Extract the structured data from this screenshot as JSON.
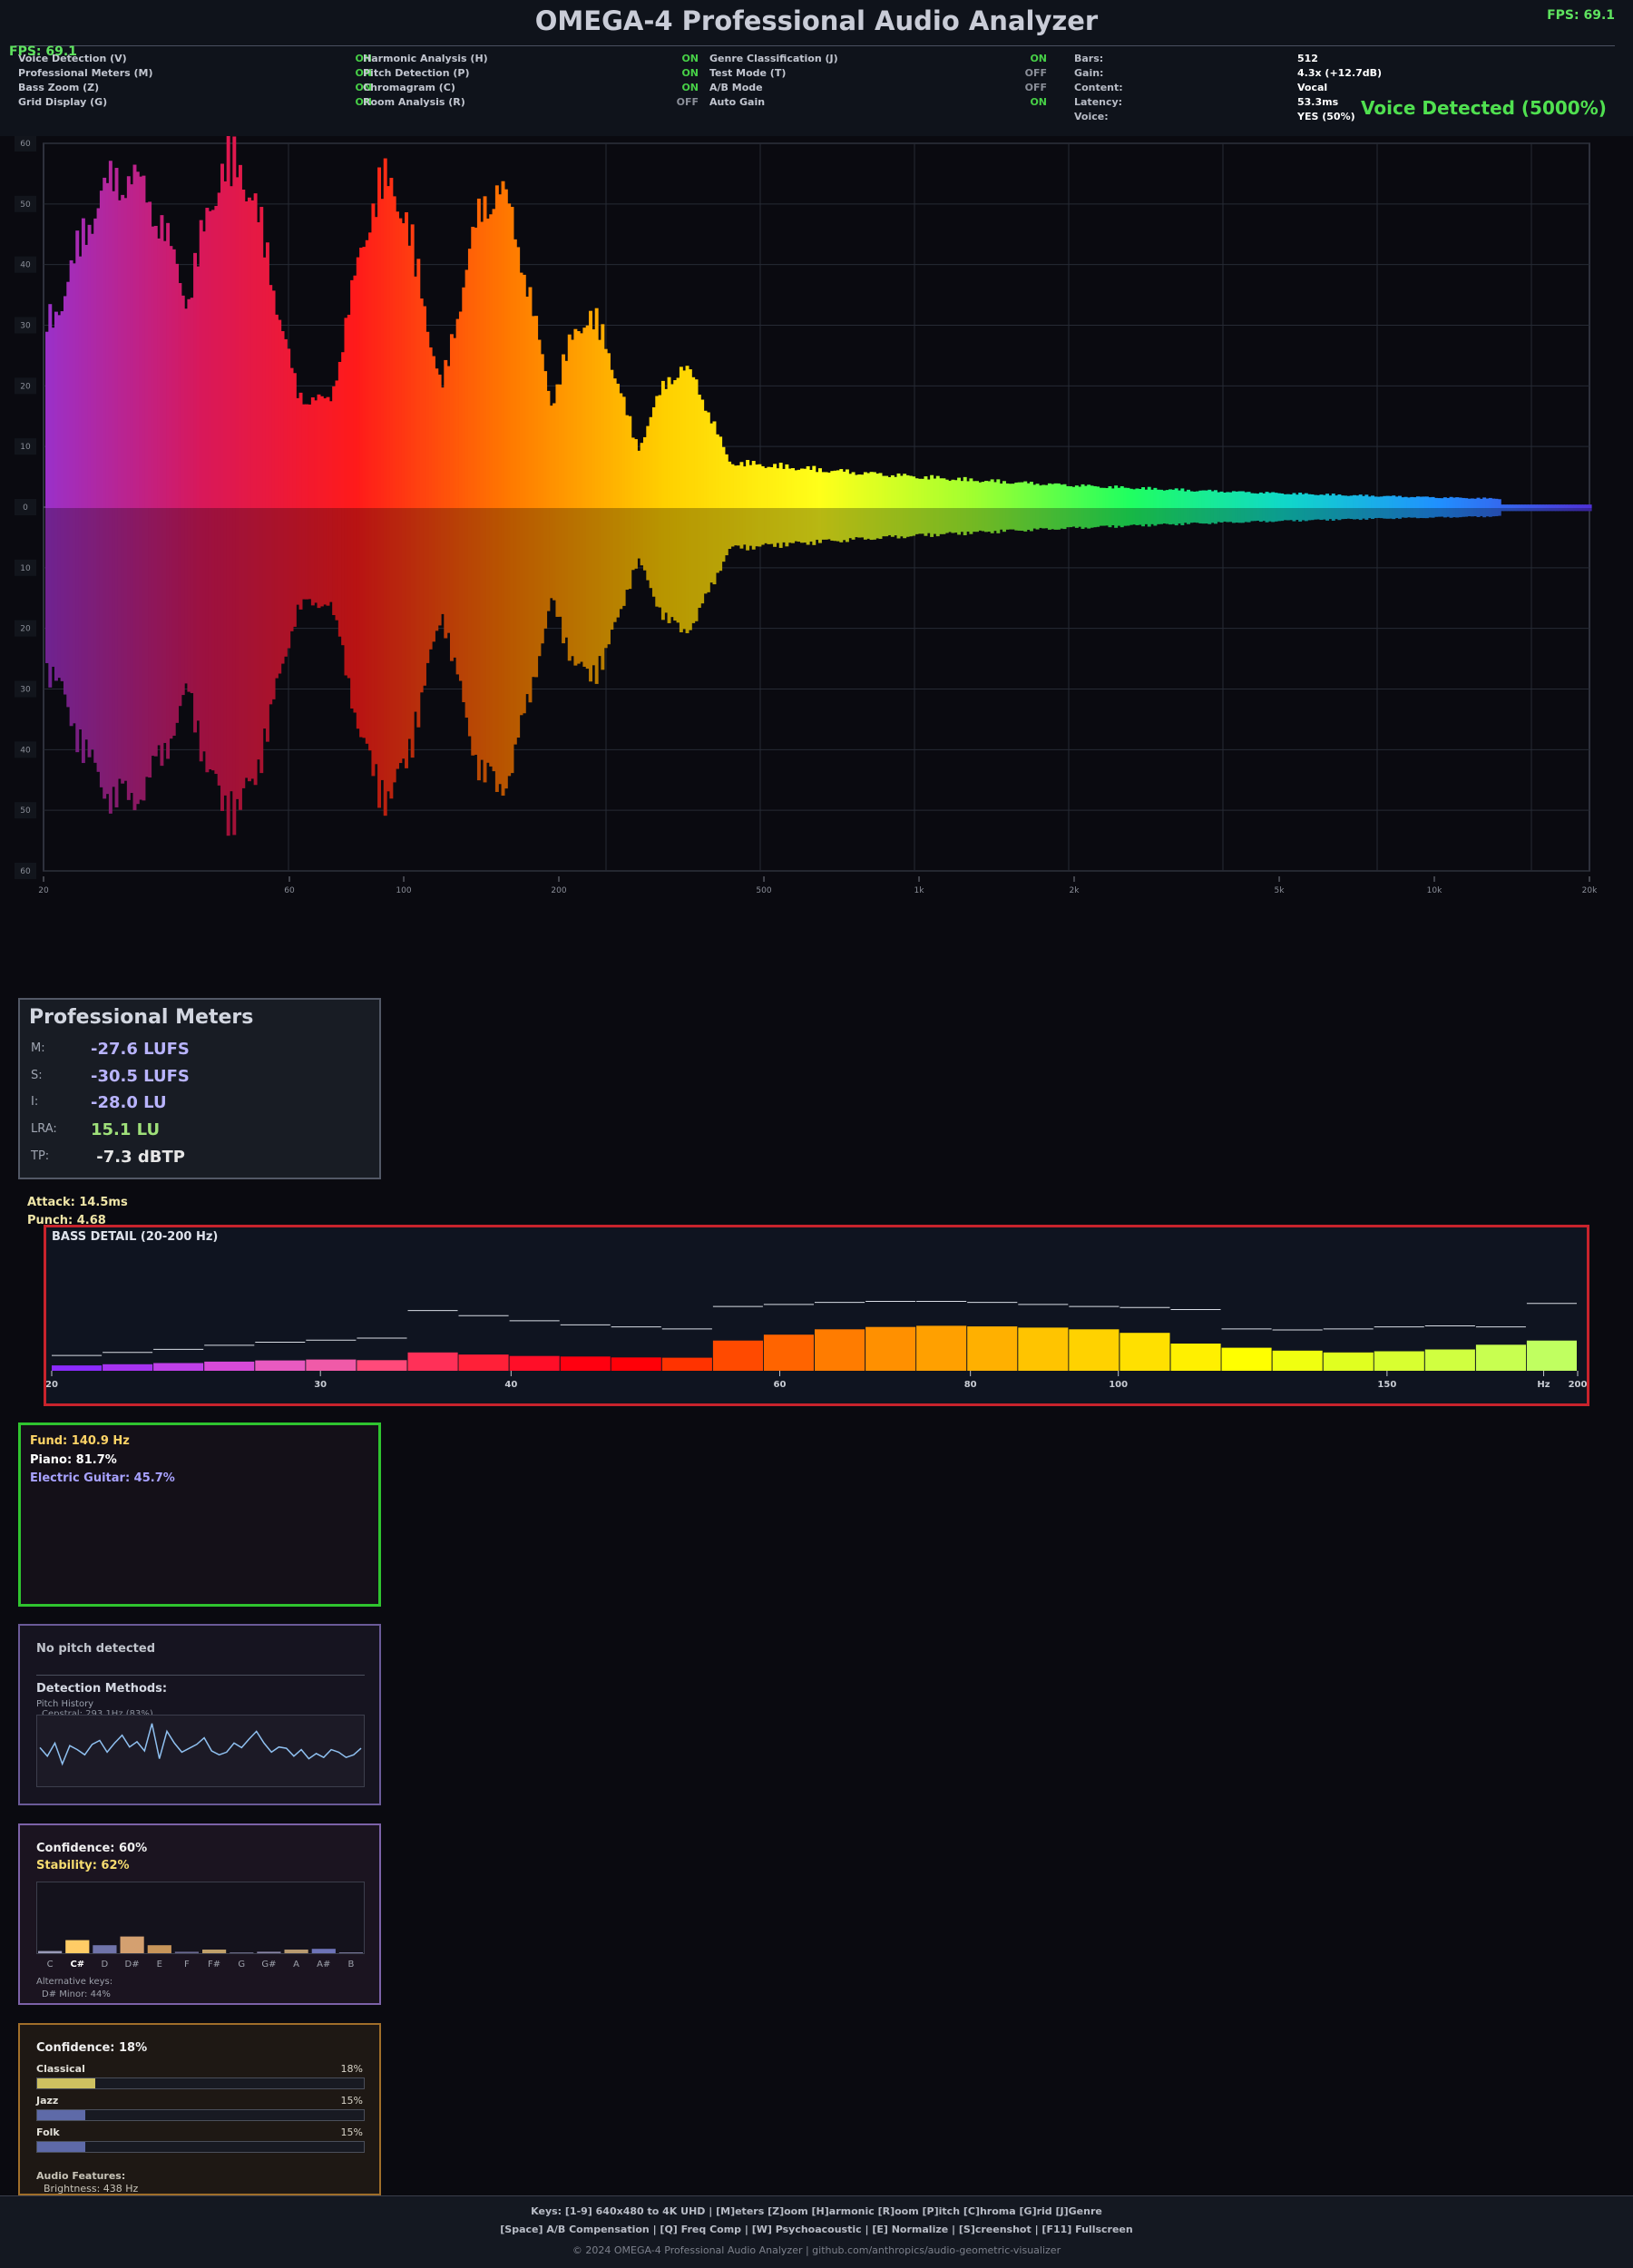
{
  "app": {
    "title": "OMEGA-4 Professional Audio Analyzer",
    "fps": "FPS: 69.1",
    "voice_status": "Voice Detected (5000%)"
  },
  "toggles": [
    {
      "label": "Voice Detection (V)",
      "state": "ON"
    },
    {
      "label": "Professional Meters (M)",
      "state": "ON"
    },
    {
      "label": "Bass Zoom (Z)",
      "state": "ON"
    },
    {
      "label": "Grid Display (G)",
      "state": "ON"
    },
    {
      "label": "Harmonic Analysis (H)",
      "state": "ON"
    },
    {
      "label": "Pitch Detection (P)",
      "state": "ON"
    },
    {
      "label": "Chromagram (C)",
      "state": "ON"
    },
    {
      "label": "Room Analysis (R)",
      "state": "OFF"
    },
    {
      "label": "Genre Classification (J)",
      "state": "ON"
    },
    {
      "label": "Test Mode (T)",
      "state": "OFF"
    },
    {
      "label": "A/B Mode",
      "state": "OFF"
    },
    {
      "label": "Auto Gain",
      "state": "ON"
    }
  ],
  "info": [
    {
      "key": "Bars:",
      "value": "512"
    },
    {
      "key": "Gain:",
      "value": "4.3x (+12.7dB)"
    },
    {
      "key": "Content:",
      "value": "Vocal"
    },
    {
      "key": "Latency:",
      "value": "53.3ms"
    },
    {
      "key": "Voice:",
      "value": "YES (50%)"
    }
  ],
  "spectrum": {
    "db_labels": [
      "60",
      "50",
      "40",
      "30",
      "20",
      "10",
      "0",
      "10",
      "20",
      "30",
      "40",
      "50",
      "60"
    ],
    "freq_labels": [
      {
        "label": "20",
        "hz": 20
      },
      {
        "label": "60",
        "hz": 60
      },
      {
        "label": "100",
        "hz": 100
      },
      {
        "label": "200",
        "hz": 200
      },
      {
        "label": "500",
        "hz": 500
      },
      {
        "label": "1k",
        "hz": 1000
      },
      {
        "label": "2k",
        "hz": 2000
      },
      {
        "label": "5k",
        "hz": 5000
      },
      {
        "label": "10k",
        "hz": 10000
      },
      {
        "label": "20k",
        "hz": 20000
      }
    ],
    "db_range": [
      -60,
      60
    ],
    "freq_range": [
      20,
      20000
    ],
    "colors": [
      "#9b30c8",
      "#d8185a",
      "#ff1a1a",
      "#ff7a00",
      "#ffd000",
      "#ffff1a",
      "#a0ff30",
      "#20ff60",
      "#10d8c8",
      "#2090ff",
      "#5030d8"
    ]
  },
  "meters": {
    "title": "Professional Meters",
    "rows": [
      {
        "label": "M:",
        "value": "-27.6 LUFS",
        "color": "#b9b4ff"
      },
      {
        "label": "S:",
        "value": "-30.5 LUFS",
        "color": "#b9b4ff"
      },
      {
        "label": "I:",
        "value": "-28.0 LU",
        "color": "#b9b4ff"
      },
      {
        "label": "LRA:",
        "value": "15.1 LU",
        "color": "#9fe07a"
      },
      {
        "label": "TP:",
        "value": " -7.3 dBTP",
        "color": "#e6e6e6"
      }
    ]
  },
  "transients": {
    "attack": "Attack: 14.5ms",
    "punch": "Punch: 4.68"
  },
  "bass": {
    "title": "BASS DETAIL (20-200 Hz)",
    "freq_labels": [
      {
        "label": "20",
        "hz": 20
      },
      {
        "label": "30",
        "hz": 30
      },
      {
        "label": "40",
        "hz": 40
      },
      {
        "label": "60",
        "hz": 60
      },
      {
        "label": "80",
        "hz": 80
      },
      {
        "label": "100",
        "hz": 100
      },
      {
        "label": "150",
        "hz": 150
      },
      {
        "label": "Hz",
        "hz": 190
      },
      {
        "label": "200",
        "hz": 200
      }
    ],
    "levels": [
      0.18,
      0.22,
      0.26,
      0.31,
      0.35,
      0.38,
      0.36,
      0.62,
      0.55,
      0.5,
      0.48,
      0.45,
      0.44,
      1.02,
      1.22,
      1.4,
      1.48,
      1.52,
      1.5,
      1.46,
      1.4,
      1.28,
      0.92,
      0.78,
      0.68,
      0.62,
      0.66,
      0.72,
      0.88,
      1.02
    ],
    "peaks": [
      0.3,
      0.36,
      0.42,
      0.5,
      0.56,
      0.6,
      0.64,
      1.18,
      1.08,
      0.98,
      0.9,
      0.86,
      0.82,
      1.26,
      1.3,
      1.34,
      1.36,
      1.36,
      1.34,
      1.3,
      1.26,
      1.24,
      1.2,
      0.82,
      0.8,
      0.82,
      0.86,
      0.88,
      0.86,
      1.32
    ],
    "colors": [
      "#8b2bff",
      "#a633f0",
      "#c040e8",
      "#d84ad8",
      "#e85ac0",
      "#f05aa8",
      "#ff4a7a",
      "#ff3058",
      "#ff2038",
      "#ff0e28",
      "#ff0010",
      "#ff0008",
      "#ff3300",
      "#ff4a00",
      "#ff6400",
      "#ff7c00",
      "#ff9000",
      "#ffa000",
      "#ffb000",
      "#ffc400",
      "#ffd200",
      "#ffe000",
      "#fff000",
      "#ffff00",
      "#f0ff10",
      "#e0ff20",
      "#d8ff30",
      "#d0ff40",
      "#c8ff50",
      "#c0ff60"
    ]
  },
  "harmonic": {
    "fundamental": "Fund: 140.9 Hz",
    "instruments": [
      "Piano: 81.7%",
      "Electric Guitar: 45.7%"
    ]
  },
  "pitch": {
    "status": "No pitch detected",
    "methods_label": "Detection Methods:",
    "history_label": "Pitch History",
    "cepstral": "Cepstral: 293.1Hz (83%)",
    "history": [
      0.55,
      0.42,
      0.62,
      0.3,
      0.58,
      0.52,
      0.44,
      0.6,
      0.66,
      0.48,
      0.62,
      0.74,
      0.56,
      0.64,
      0.5,
      0.92,
      0.38,
      0.8,
      0.62,
      0.48,
      0.54,
      0.6,
      0.7,
      0.5,
      0.44,
      0.48,
      0.62,
      0.55,
      0.68,
      0.8,
      0.62,
      0.48,
      0.56,
      0.54,
      0.42,
      0.52,
      0.38,
      0.46,
      0.4,
      0.52,
      0.48,
      0.4,
      0.44,
      0.54
    ]
  },
  "chroma": {
    "confidence": "Confidence: 60%",
    "stability": "Stability: 62%",
    "notes": [
      "C",
      "C#",
      "D",
      "D#",
      "E",
      "F",
      "F#",
      "G",
      "G#",
      "A",
      "A#",
      "B"
    ],
    "values": [
      0.03,
      0.18,
      0.11,
      0.23,
      0.11,
      0.02,
      0.05,
      0.01,
      0.02,
      0.05,
      0.06,
      0.01
    ],
    "colors": [
      "#9a9ab8",
      "#ffcc66",
      "#7074aa",
      "#d4a070",
      "#c8955a",
      "#6a6a92",
      "#c0a06a",
      "#7a7a9a",
      "#8a86a8",
      "#b89a70",
      "#6e74b8",
      "#8a8ab0"
    ],
    "alt_title": "Alternative keys:",
    "alt_keys": [
      "D# Minor: 44%"
    ]
  },
  "genre": {
    "confidence": "Confidence: 18%",
    "items": [
      {
        "name": "Classical",
        "pct": "18%",
        "value": 0.18,
        "color": "#cdc060"
      },
      {
        "name": "Jazz",
        "pct": "15%",
        "value": 0.15,
        "color": "#5e6aa8"
      },
      {
        "name": "Folk",
        "pct": "15%",
        "value": 0.15,
        "color": "#5e6aa8"
      }
    ],
    "features_label": "Audio Features:",
    "brightness": "Brightness: 438 Hz"
  },
  "footer": {
    "keys1": "Keys: [1-9] 640x480 to 4K UHD | [M]eters [Z]oom [H]armonic [R]oom [P]itch [C]hroma [G]rid [J]Genre",
    "keys2": "[Space] A/B Compensation | [Q] Freq Comp | [W] Psychoacoustic | [E] Normalize | [S]creenshot | [F11] Fullscreen",
    "copyright": "© 2024 OMEGA-4 Professional Audio Analyzer | github.com/anthropics/audio-geometric-visualizer"
  }
}
